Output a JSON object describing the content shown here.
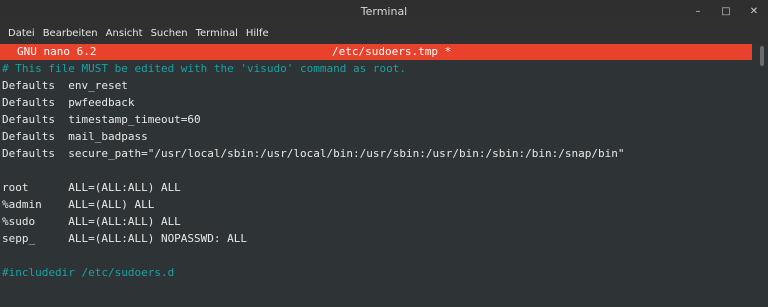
{
  "window": {
    "title": "Terminal",
    "controls": {
      "minimize": "–",
      "maximize": "□",
      "close": "✕"
    }
  },
  "menu": {
    "items": [
      {
        "label": "Datei"
      },
      {
        "label": "Bearbeiten"
      },
      {
        "label": "Ansicht"
      },
      {
        "label": "Suchen"
      },
      {
        "label": "Terminal"
      },
      {
        "label": "Hilfe"
      }
    ]
  },
  "nano": {
    "version": "GNU nano 6.2",
    "filename": "/etc/sudoers.tmp *",
    "colors": {
      "header_bg": "#e8412c",
      "comment": "#17a2a2",
      "background": "#2e3436"
    }
  },
  "content": {
    "lines": [
      {
        "text": "# This file MUST be edited with the 'visudo' command as root.",
        "type": "comment"
      },
      {
        "text": "Defaults  env_reset",
        "type": "normal"
      },
      {
        "text": "Defaults  pwfeedback",
        "type": "normal"
      },
      {
        "text": "Defaults  timestamp_timeout=60",
        "type": "normal"
      },
      {
        "text": "Defaults  mail_badpass",
        "type": "normal"
      },
      {
        "text": "Defaults  secure_path=\"/usr/local/sbin:/usr/local/bin:/usr/sbin:/usr/bin:/sbin:/bin:/snap/bin\"",
        "type": "normal"
      },
      {
        "text": "",
        "type": "normal"
      },
      {
        "text": "root      ALL=(ALL:ALL) ALL",
        "type": "normal"
      },
      {
        "text": "%admin    ALL=(ALL) ALL",
        "type": "normal"
      },
      {
        "text": "%sudo     ALL=(ALL:ALL) ALL",
        "type": "normal"
      },
      {
        "text": "sepp_     ALL=(ALL:ALL) NOPASSWD: ALL",
        "type": "normal"
      },
      {
        "text": "",
        "type": "normal"
      },
      {
        "text": "#includedir /etc/sudoers.d",
        "type": "comment"
      }
    ]
  }
}
